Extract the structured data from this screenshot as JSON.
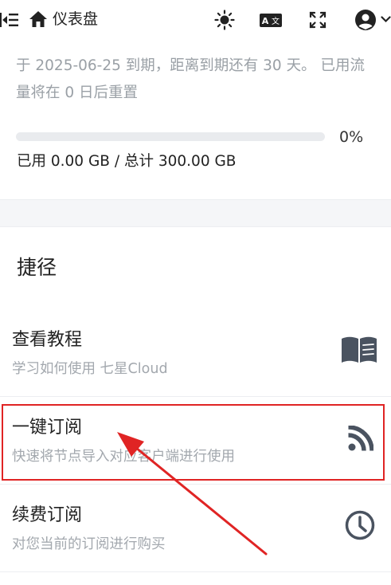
{
  "header": {
    "title": "仪表盘",
    "icons": [
      "menu-collapse-icon",
      "home-icon",
      "theme-sun-icon",
      "translate-icon",
      "fullscreen-icon",
      "user-avatar-icon",
      "chevron-down-icon"
    ]
  },
  "subscription": {
    "expire_text": "于 2025-06-25 到期，距离到期还有 30 天。 已用流量将在 0 日后重置",
    "usage_percent": 0,
    "usage_percent_label": "0%",
    "usage_text": "已用 0.00 GB / 总计 300.00 GB"
  },
  "shortcuts": {
    "title": "捷径",
    "items": [
      {
        "title": "查看教程",
        "desc": "学习如何使用 七星Cloud",
        "icon": "book-icon"
      },
      {
        "title": "一键订阅",
        "desc": "快速将节点导入对应客户端进行使用",
        "icon": "rss-icon"
      },
      {
        "title": "续费订阅",
        "desc": "对您当前的订阅进行购买",
        "icon": "clock-icon"
      }
    ]
  },
  "colors": {
    "highlight": "#e02424",
    "muted_text": "#9aa0a6",
    "icon": "#4a5360",
    "progress_fill": "#4a8af4",
    "progress_track": "#e9ebee"
  }
}
